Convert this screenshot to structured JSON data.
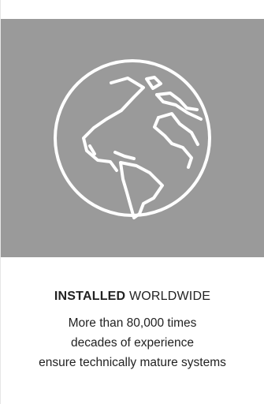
{
  "feature": {
    "icon": "globe-icon",
    "title_strong": "INSTALLED",
    "title_light": "WORLDWIDE",
    "description_lines": [
      "More than 80,000 times",
      "decades of experience",
      "ensure technically mature systems"
    ]
  },
  "colors": {
    "hero_background": "#9a9a9a",
    "icon_stroke": "#ffffff",
    "text": "#222222"
  }
}
